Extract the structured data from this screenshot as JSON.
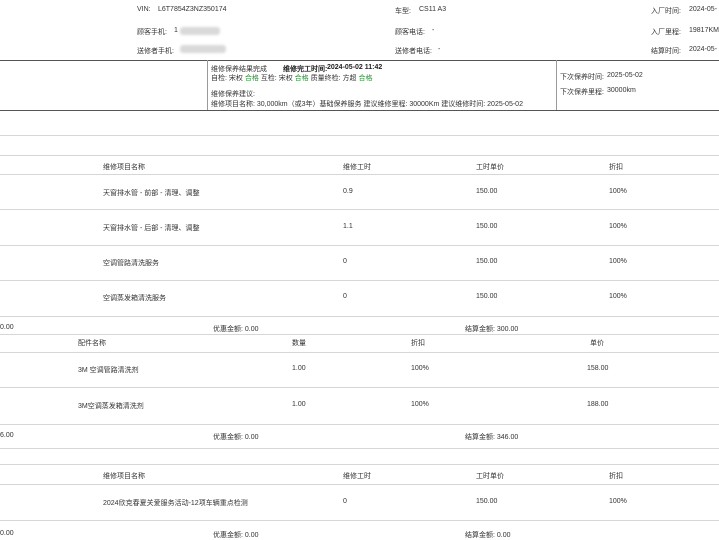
{
  "vehicle": {
    "vin_label": "VIN:",
    "vin_value": "L6T7854Z3NZ350174",
    "model_label": "车型:",
    "model_value": "CS11 A3",
    "entry_time_label": "入厂时间:",
    "entry_time_value": "2024-05-",
    "customer_phone_label": "顾客手机:",
    "customer_phone_value": "1",
    "customer_tel_label": "顾客电话:",
    "customer_tel_value": "-",
    "mileage_label": "入厂里程:",
    "mileage_value": "19817KM",
    "sender_phone_label": "送修者手机:",
    "sender_tel_label": "送修者电话:",
    "sender_tel_value": "-",
    "settle_time_label": "结算时间:",
    "settle_time_value": "2024-05-"
  },
  "result": {
    "status_label": "维修保养结果:",
    "status_value": "完成",
    "finish_time_label": "维修完工时间:",
    "finish_time_value": "2024-05-02 11:42",
    "self_check_label": "自检:",
    "self_check_by": "宋权",
    "self_check_status": "合格",
    "mutual_check_label": "互检:",
    "mutual_check_by": "宋权",
    "mutual_check_status": "合格",
    "quality_check_label": "质量终检:",
    "quality_check_by": "方超",
    "quality_check_status": "合格",
    "advice_label": "维修保养建议:",
    "project_line": "维修项目名称: 30,000km（或3年）基础保养服务 建议维修里程: 30000Km 建议维修时间: 2025-05-02",
    "next_time_label": "下次保养时间:",
    "next_time_value": "2025-05-02",
    "next_mileage_label": "下次保养里程:",
    "next_mileage_value": "30000km"
  },
  "labor": {
    "headers": [
      "维修项目名称",
      "维修工时",
      "工时单价",
      "折扣"
    ],
    "rows": [
      {
        "name": "天窗排水管 - 前部 - 清理、调整",
        "hours": "0.9",
        "price": "150.00",
        "discount": "100%"
      },
      {
        "name": "天窗排水管 - 后部 - 清理、调整",
        "hours": "1.1",
        "price": "150.00",
        "discount": "100%"
      },
      {
        "name": "空调管路清洗服务",
        "hours": "0",
        "price": "150.00",
        "discount": "100%"
      },
      {
        "name": "空调蒸发箱清洗服务",
        "hours": "0",
        "price": "150.00",
        "discount": "100%"
      }
    ],
    "footer": {
      "left": "0.00",
      "discount": "优惠金额: 0.00",
      "settle": "结算金额: 300.00"
    }
  },
  "parts": {
    "headers": [
      "配件名称",
      "数量",
      "折扣",
      "单价"
    ],
    "rows": [
      {
        "name": "3M 空调管路清洗剂",
        "qty": "1.00",
        "discount": "100%",
        "price": "158.00"
      },
      {
        "name": "3M空调蒸发箱清洗剂",
        "qty": "1.00",
        "discount": "100%",
        "price": "188.00"
      }
    ],
    "footer": {
      "left": "6.00",
      "discount": "优惠金额: 0.00",
      "settle": "结算金额: 346.00"
    }
  },
  "activity": {
    "headers": [
      "维修项目名称",
      "维修工时",
      "工时单价",
      "折扣"
    ],
    "rows": [
      {
        "name": "2024欣克春夏关爱服务活动-12项车辆重点检测",
        "hours": "0",
        "price": "150.00",
        "discount": "100%"
      }
    ],
    "footer": {
      "left": "0.00",
      "discount": "优惠金额: 0.00",
      "settle": "结算金额: 0.00"
    }
  }
}
